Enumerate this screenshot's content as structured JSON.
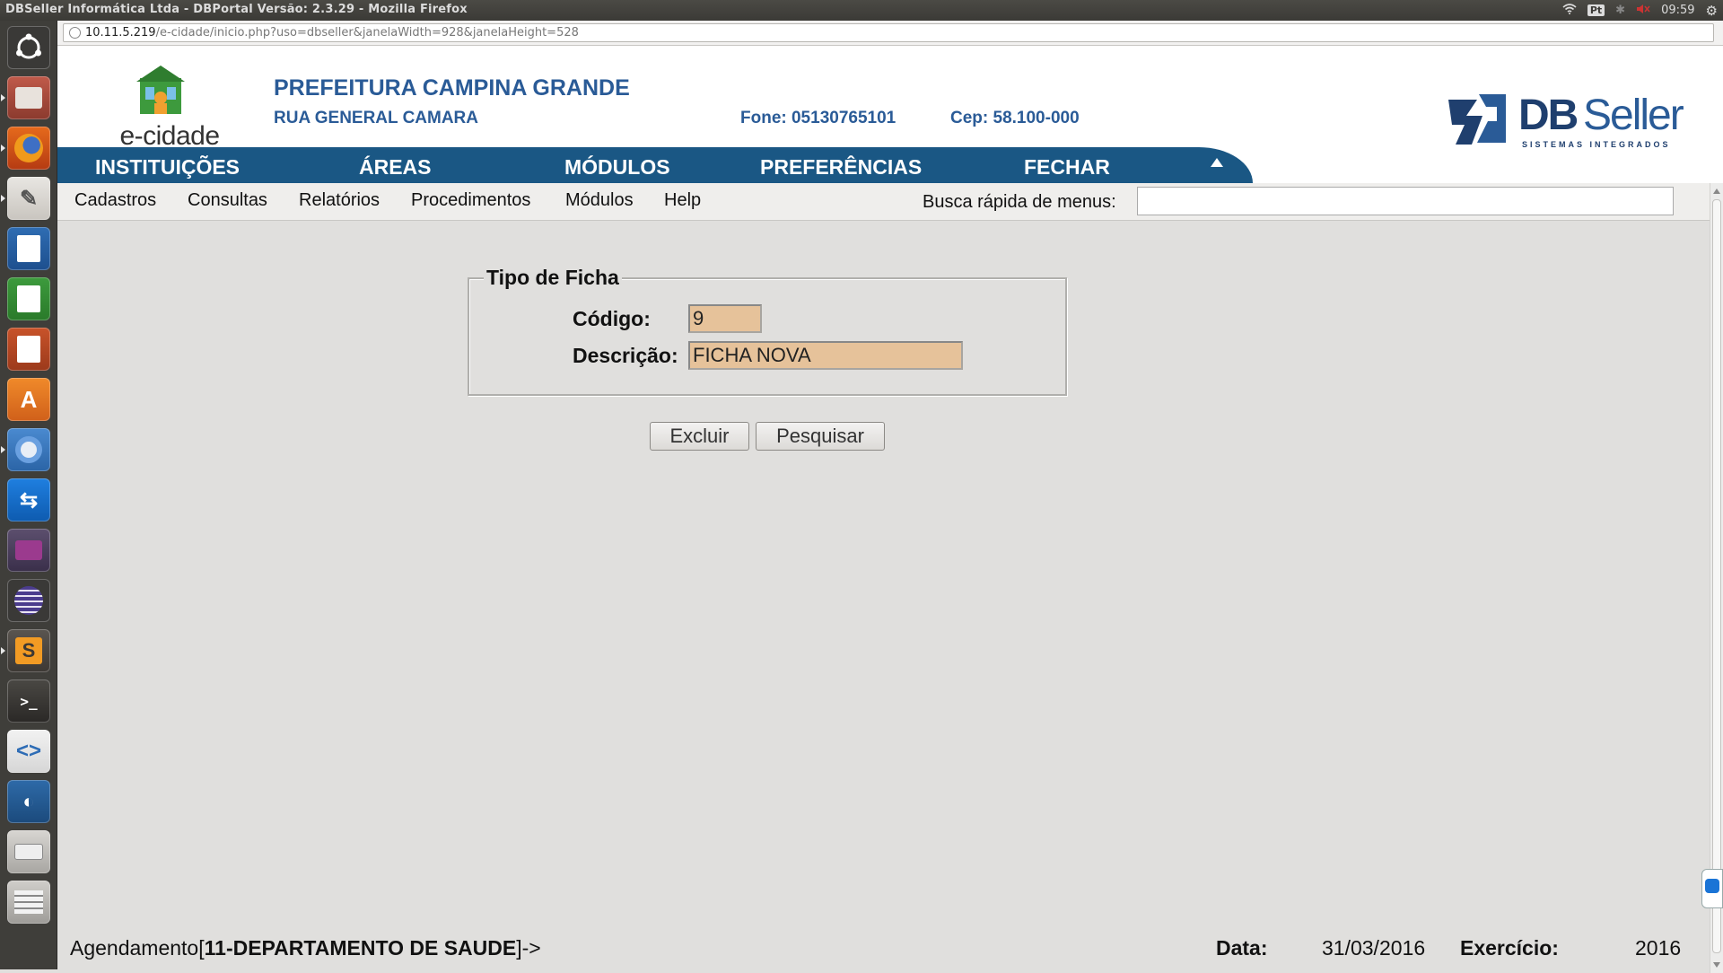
{
  "window": {
    "title": "DBSeller Informática Ltda - DBPortal Versão: 2.3.29 - Mozilla Firefox"
  },
  "systray": {
    "keyboard": "Pt",
    "time": "09:59"
  },
  "browser": {
    "url_host": "10.11.5.219",
    "url_path": "/e-cidade/inicio.php?uso=dbseller&janelaWidth=928&janelaHeight=528"
  },
  "header": {
    "logo_text": "e-cidade",
    "org_name": "PREFEITURA CAMPINA GRANDE",
    "address": "RUA GENERAL CAMARA",
    "phone": "Fone: 05130765101",
    "cep": "Cep: 58.100-000",
    "vendor_logo": {
      "db": "DB",
      "seller": "Seller",
      "tagline": "SISTEMAS INTEGRADOS"
    }
  },
  "main_nav": {
    "items": [
      {
        "label": "INSTITUIÇÕES"
      },
      {
        "label": "ÁREAS"
      },
      {
        "label": "MÓDULOS"
      },
      {
        "label": "PREFERÊNCIAS"
      },
      {
        "label": "FECHAR"
      }
    ]
  },
  "sub_menu": {
    "items": [
      {
        "label": "Cadastros"
      },
      {
        "label": "Consultas"
      },
      {
        "label": "Relatórios"
      },
      {
        "label": "Procedimentos"
      },
      {
        "label": "Módulos"
      },
      {
        "label": "Help"
      }
    ],
    "quick_search_label": "Busca rápida de menus:",
    "quick_search_value": ""
  },
  "form": {
    "legend": "Tipo de Ficha",
    "codigo_label": "Código:",
    "codigo_value": "9",
    "descricao_label": "Descrição:",
    "descricao_value": "FICHA NOVA",
    "buttons": {
      "delete": "Excluir",
      "search": "Pesquisar"
    }
  },
  "footer": {
    "module_prefix": "Agendamento[",
    "department": "11-DEPARTAMENTO DE SAUDE",
    "module_suffix": "]->",
    "date_label": "Data:",
    "date_value": "31/03/2016",
    "year_label": "Exercício:",
    "year_value": "2016"
  },
  "colors": {
    "brand_blue": "#1a5784",
    "header_text": "#2a5b97",
    "field_fill": "#e6c29a",
    "background": "#e0dfdd"
  }
}
